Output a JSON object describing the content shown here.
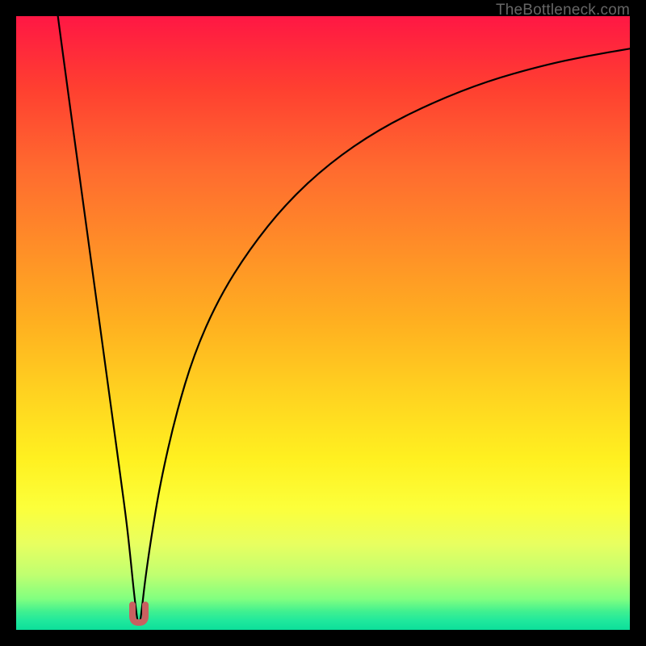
{
  "watermark": "TheBottleneck.com",
  "chart_data": {
    "type": "line",
    "title": "",
    "xlabel": "",
    "ylabel": "",
    "xlim": [
      0,
      100
    ],
    "ylim": [
      0,
      100
    ],
    "grid": false,
    "background_gradient": {
      "orientation": "vertical",
      "stops": [
        {
          "pos": 0.0,
          "color": "#ff1744"
        },
        {
          "pos": 0.12,
          "color": "#ff4030"
        },
        {
          "pos": 0.25,
          "color": "#ff6b2f"
        },
        {
          "pos": 0.37,
          "color": "#ff8c28"
        },
        {
          "pos": 0.5,
          "color": "#ffb020"
        },
        {
          "pos": 0.62,
          "color": "#ffd420"
        },
        {
          "pos": 0.72,
          "color": "#fff020"
        },
        {
          "pos": 0.8,
          "color": "#fcff3a"
        },
        {
          "pos": 0.86,
          "color": "#e8ff60"
        },
        {
          "pos": 0.91,
          "color": "#c0ff70"
        },
        {
          "pos": 0.95,
          "color": "#80ff80"
        },
        {
          "pos": 0.97,
          "color": "#40f090"
        },
        {
          "pos": 1.0,
          "color": "#0cdf9a"
        }
      ]
    },
    "series": [
      {
        "name": "curve",
        "color": "#000000",
        "points": [
          [
            6.8,
            100.0
          ],
          [
            8.0,
            91.0
          ],
          [
            9.5,
            80.0
          ],
          [
            11.0,
            69.0
          ],
          [
            12.5,
            58.0
          ],
          [
            14.0,
            47.0
          ],
          [
            15.5,
            36.0
          ],
          [
            17.0,
            25.0
          ],
          [
            18.0,
            17.5
          ],
          [
            18.6,
            12.0
          ],
          [
            19.1,
            7.0
          ],
          [
            19.5,
            3.5
          ],
          [
            19.8,
            1.3
          ],
          [
            20.0,
            1.0
          ],
          [
            20.2,
            1.3
          ],
          [
            20.5,
            3.5
          ],
          [
            21.0,
            8.0
          ],
          [
            22.0,
            15.0
          ],
          [
            23.5,
            24.0
          ],
          [
            26.0,
            35.0
          ],
          [
            29.0,
            45.0
          ],
          [
            33.0,
            54.0
          ],
          [
            38.0,
            62.0
          ],
          [
            44.0,
            69.5
          ],
          [
            51.0,
            76.0
          ],
          [
            59.0,
            81.5
          ],
          [
            68.0,
            86.0
          ],
          [
            77.0,
            89.5
          ],
          [
            86.0,
            92.0
          ],
          [
            93.0,
            93.5
          ],
          [
            100.0,
            94.7
          ]
        ]
      }
    ],
    "marker": {
      "shape": "u",
      "x": 20.0,
      "y": 1.0,
      "color": "#c96060",
      "thickness_px": 8
    }
  }
}
